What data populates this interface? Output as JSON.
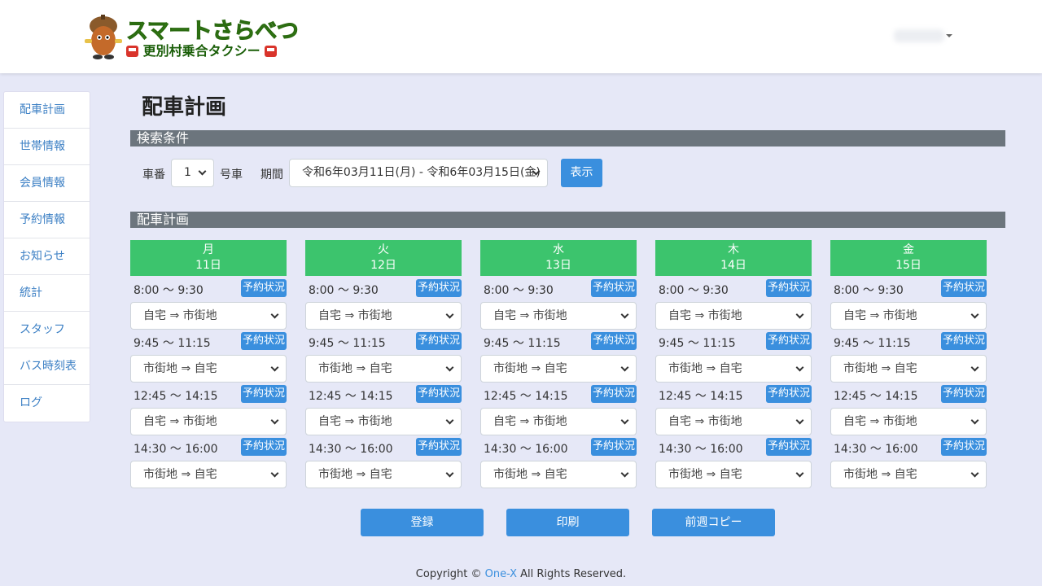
{
  "header": {
    "logo_title": "スマートさらべつ",
    "logo_subtitle": "更別村乗合タクシー"
  },
  "sidebar": {
    "items": [
      {
        "label": "配車計画"
      },
      {
        "label": "世帯情報"
      },
      {
        "label": "会員情報"
      },
      {
        "label": "予約情報"
      },
      {
        "label": "お知らせ"
      },
      {
        "label": "統計"
      },
      {
        "label": "スタッフ"
      },
      {
        "label": "バス時刻表"
      },
      {
        "label": "ログ"
      }
    ]
  },
  "page": {
    "title": "配車計画"
  },
  "search": {
    "section_title": "検索条件",
    "car_label": "車番",
    "car_value": "1",
    "car_suffix": "号車",
    "period_label": "期間",
    "period_value": "令和6年03月11日(月) - 令和6年03月15日(金)",
    "show_button": "表示"
  },
  "plan": {
    "section_title": "配車計画",
    "status_label": "予約状況",
    "days": [
      {
        "name": "月",
        "date": "11日",
        "slots": [
          {
            "time": "8:00 〜 9:30",
            "route": "自宅 ⇒ 市街地"
          },
          {
            "time": "9:45 〜 11:15",
            "route": "市街地 ⇒ 自宅"
          },
          {
            "time": "12:45 〜 14:15",
            "route": "自宅 ⇒ 市街地"
          },
          {
            "time": "14:30 〜 16:00",
            "route": "市街地 ⇒ 自宅"
          }
        ]
      },
      {
        "name": "火",
        "date": "12日",
        "slots": [
          {
            "time": "8:00 〜 9:30",
            "route": "自宅 ⇒ 市街地"
          },
          {
            "time": "9:45 〜 11:15",
            "route": "市街地 ⇒ 自宅"
          },
          {
            "time": "12:45 〜 14:15",
            "route": "自宅 ⇒ 市街地"
          },
          {
            "time": "14:30 〜 16:00",
            "route": "市街地 ⇒ 自宅"
          }
        ]
      },
      {
        "name": "水",
        "date": "13日",
        "slots": [
          {
            "time": "8:00 〜 9:30",
            "route": "自宅 ⇒ 市街地"
          },
          {
            "time": "9:45 〜 11:15",
            "route": "市街地 ⇒ 自宅"
          },
          {
            "time": "12:45 〜 14:15",
            "route": "自宅 ⇒ 市街地"
          },
          {
            "time": "14:30 〜 16:00",
            "route": "市街地 ⇒ 自宅"
          }
        ]
      },
      {
        "name": "木",
        "date": "14日",
        "slots": [
          {
            "time": "8:00 〜 9:30",
            "route": "自宅 ⇒ 市街地"
          },
          {
            "time": "9:45 〜 11:15",
            "route": "市街地 ⇒ 自宅"
          },
          {
            "time": "12:45 〜 14:15",
            "route": "自宅 ⇒ 市街地"
          },
          {
            "time": "14:30 〜 16:00",
            "route": "市街地 ⇒ 自宅"
          }
        ]
      },
      {
        "name": "金",
        "date": "15日",
        "slots": [
          {
            "time": "8:00 〜 9:30",
            "route": "自宅 ⇒ 市街地"
          },
          {
            "time": "9:45 〜 11:15",
            "route": "市街地 ⇒ 自宅"
          },
          {
            "time": "12:45 〜 14:15",
            "route": "自宅 ⇒ 市街地"
          },
          {
            "time": "14:30 〜 16:00",
            "route": "市街地 ⇒ 自宅"
          }
        ]
      }
    ]
  },
  "actions": {
    "register": "登録",
    "print": "印刷",
    "copy_prev_week": "前週コピー"
  },
  "footer": {
    "copyright_prefix": "Copyright © ",
    "company": "One-X",
    "rights": " All Rights Reserved."
  },
  "colors": {
    "accent_blue": "#3a8fde",
    "day_header_green": "#3cc46d",
    "section_bar_gray": "#6c757d",
    "background": "#e6e8f7"
  }
}
